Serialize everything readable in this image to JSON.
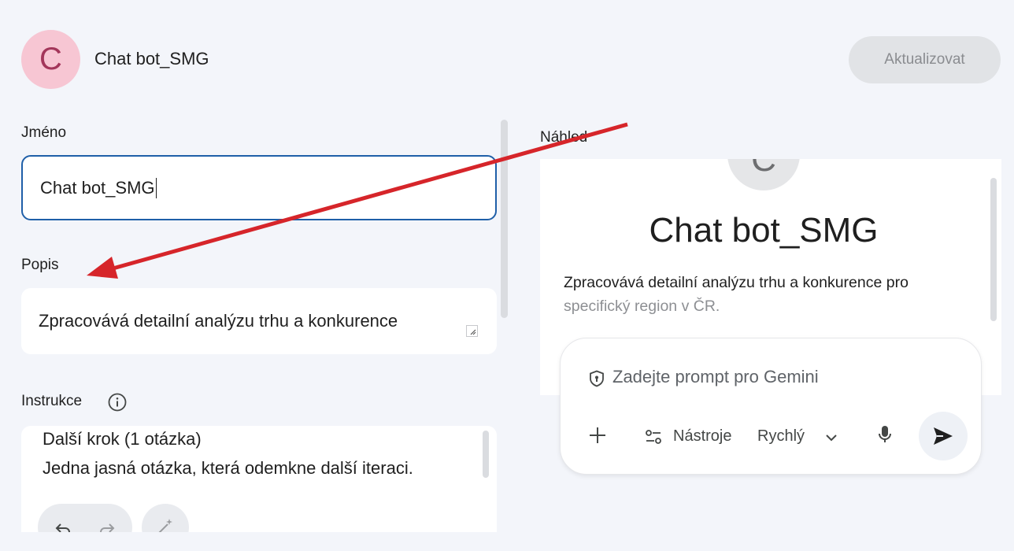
{
  "header": {
    "avatar_letter": "C",
    "title": "Chat bot_SMG",
    "update_label": "Aktualizovat"
  },
  "form": {
    "name_label": "Jméno",
    "name_value": "Chat bot_SMG",
    "description_label": "Popis",
    "description_value": "Zpracovává detailní analýzu trhu a konkurence",
    "instructions_label": "Instrukce",
    "instructions_lines": [
      "Další krok (1 otázka)",
      "Jedna jasná otázka, která odemkne další iteraci."
    ]
  },
  "preview": {
    "label": "Náhled",
    "avatar_letter": "C",
    "title": "Chat bot_SMG",
    "description_line1": "Zpracovává detailní analýzu trhu a konkurence pro",
    "description_line2": "specifický region v ČR."
  },
  "prompt": {
    "placeholder": "Zadejte prompt pro Gemini",
    "tools_label": "Nástroje",
    "model_label": "Rychlý"
  },
  "colors": {
    "accent_border": "#1f5fa8",
    "avatar_bg": "#f7c6d3",
    "annotation_arrow": "#d6252a"
  },
  "icons": [
    "info-icon",
    "undo-icon",
    "redo-icon",
    "magic-wand-icon",
    "shield-icon",
    "plus-icon",
    "tools-icon",
    "chevron-down-icon",
    "mic-icon",
    "send-icon"
  ]
}
